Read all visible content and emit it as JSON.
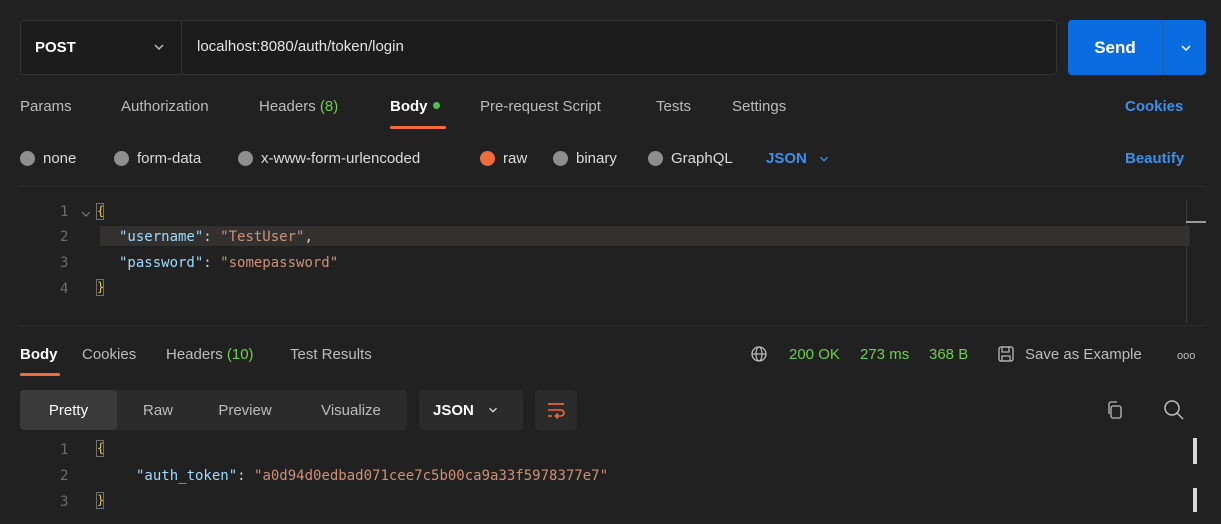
{
  "request": {
    "method": "POST",
    "url": "localhost:8080/auth/token/login",
    "send_label": "Send"
  },
  "request_tabs": {
    "params": "Params",
    "authorization": "Authorization",
    "headers_label": "Headers",
    "headers_count": "(8)",
    "body": "Body",
    "prerequest": "Pre-request Script",
    "tests": "Tests",
    "settings": "Settings",
    "cookies_link": "Cookies"
  },
  "body_types": {
    "none": "none",
    "form_data": "form-data",
    "urlencoded": "x-www-form-urlencoded",
    "raw": "raw",
    "binary": "binary",
    "graphql": "GraphQL",
    "format": "JSON",
    "beautify": "Beautify",
    "selected": "raw"
  },
  "request_body": {
    "line_numbers": [
      "1",
      "2",
      "3",
      "4"
    ],
    "username_key": "\"username\"",
    "username_value": "\"TestUser\"",
    "password_key": "\"password\"",
    "password_value": "\"somepassword\""
  },
  "response_tabs": {
    "body": "Body",
    "cookies": "Cookies",
    "headers_label": "Headers",
    "headers_count": "(10)",
    "test_results": "Test Results"
  },
  "response_meta": {
    "status": "200 OK",
    "time": "273 ms",
    "size": "368 B",
    "save_example": "Save as Example",
    "more": "ooo"
  },
  "response_view": {
    "pretty": "Pretty",
    "raw": "Raw",
    "preview": "Preview",
    "visualize": "Visualize",
    "format": "JSON"
  },
  "response_body": {
    "line_numbers": [
      "1",
      "2",
      "3"
    ],
    "auth_key": "\"auth_token\"",
    "auth_value": "\"a0d94d0edbad071cee7c5b00ca9a33f5978377e7\""
  },
  "colors": {
    "accent_orange": "#f26b3a",
    "send_blue": "#0a6ce1",
    "status_green": "#6fcf4f",
    "link_blue": "#3d8fe8"
  }
}
